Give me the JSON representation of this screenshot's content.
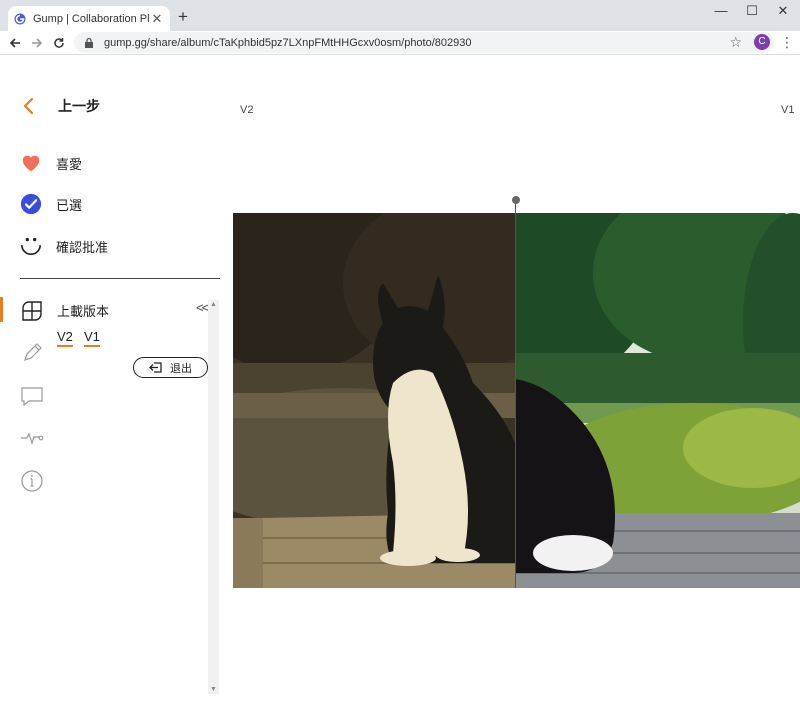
{
  "browser": {
    "tab_title": "Gump | Collaboration Platform",
    "url": "gump.gg/share/album/cTaKphbid5pz7LXnpFMtHHGcxv0osm/photo/802930",
    "avatar_letter": "C",
    "accent": "#7b3fb0"
  },
  "sidebar": {
    "back_label": "上一步",
    "items": [
      {
        "label": "喜愛",
        "icon": "heart-icon",
        "color": "#f0705a"
      },
      {
        "label": "已選",
        "icon": "check-circle-icon",
        "color": "#3b4de0"
      },
      {
        "label": "確認批准",
        "icon": "smiley-icon"
      }
    ],
    "upload_label": "上載版本",
    "versions": [
      "V2",
      "V1"
    ],
    "exit_label": "退出",
    "accent": "#e67e22"
  },
  "compare": {
    "left_version": "V2",
    "right_version": "V1"
  }
}
